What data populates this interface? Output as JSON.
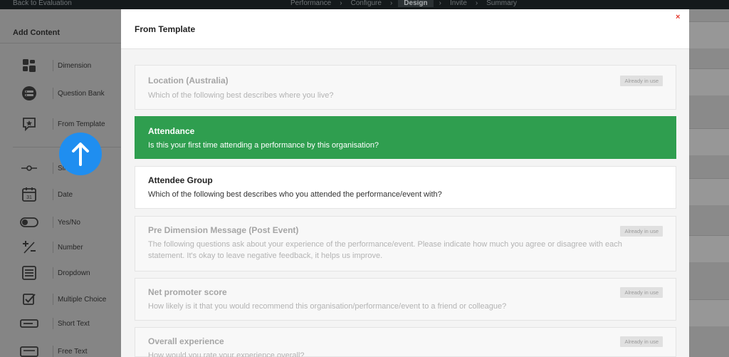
{
  "topbar": {
    "back_label": "Back to Evaluation",
    "steps": [
      {
        "label": "Performance"
      },
      {
        "label": "Configure"
      },
      {
        "label": "Design"
      },
      {
        "label": "Invite"
      },
      {
        "label": "Summary"
      }
    ],
    "active_step": "Design"
  },
  "sidebar": {
    "title": "Add Content",
    "items": [
      {
        "label": "Dimension",
        "icon": "dimension-grid-icon"
      },
      {
        "label": "Question Bank",
        "icon": "question-bank-icon"
      },
      {
        "label": "From Template",
        "icon": "template-star-icon"
      },
      {
        "label": "Sli",
        "icon": "slider-icon"
      },
      {
        "label": "Date",
        "icon": "calendar-icon"
      },
      {
        "label": "Yes/No",
        "icon": "toggle-icon"
      },
      {
        "label": "Number",
        "icon": "plus-minus-icon"
      },
      {
        "label": "Dropdown",
        "icon": "dropdown-list-icon"
      },
      {
        "label": "Multiple Choice",
        "icon": "checkbox-icon"
      },
      {
        "label": "Short Text",
        "icon": "short-text-icon"
      },
      {
        "label": "Free Text",
        "icon": "free-text-icon"
      }
    ]
  },
  "modal": {
    "title": "From Template",
    "close_label": "×",
    "items": [
      {
        "title": "Location (Australia)",
        "desc": "Which of the following best describes where you live?",
        "state": "disabled",
        "badge": "Already in use"
      },
      {
        "title": "Attendance",
        "desc": "Is this your first time attending a performance by this organisation?",
        "state": "selected",
        "badge": ""
      },
      {
        "title": "Attendee Group",
        "desc": "Which of the following best describes who you attended the performance/event with?",
        "state": "normal",
        "badge": ""
      },
      {
        "title": "Pre Dimension Message (Post Event)",
        "desc": "The following questions ask about your experience of the performance/event. Please indicate how much you agree or disagree with each statement. It's okay to leave negative feedback, it helps us improve.",
        "state": "disabled",
        "badge": "Already in use"
      },
      {
        "title": "Net promoter score",
        "desc": "How likely is it that you would recommend this organisation/performance/event to a friend or colleague?",
        "state": "disabled",
        "badge": "Already in use"
      },
      {
        "title": "Overall experience",
        "desc": "How would you rate your experience overall?",
        "state": "disabled",
        "badge": "Already in use"
      }
    ]
  },
  "colors": {
    "selected": "#2f9e4f",
    "accent_blue": "#1f8ef0",
    "close_red": "#e53a2e"
  }
}
